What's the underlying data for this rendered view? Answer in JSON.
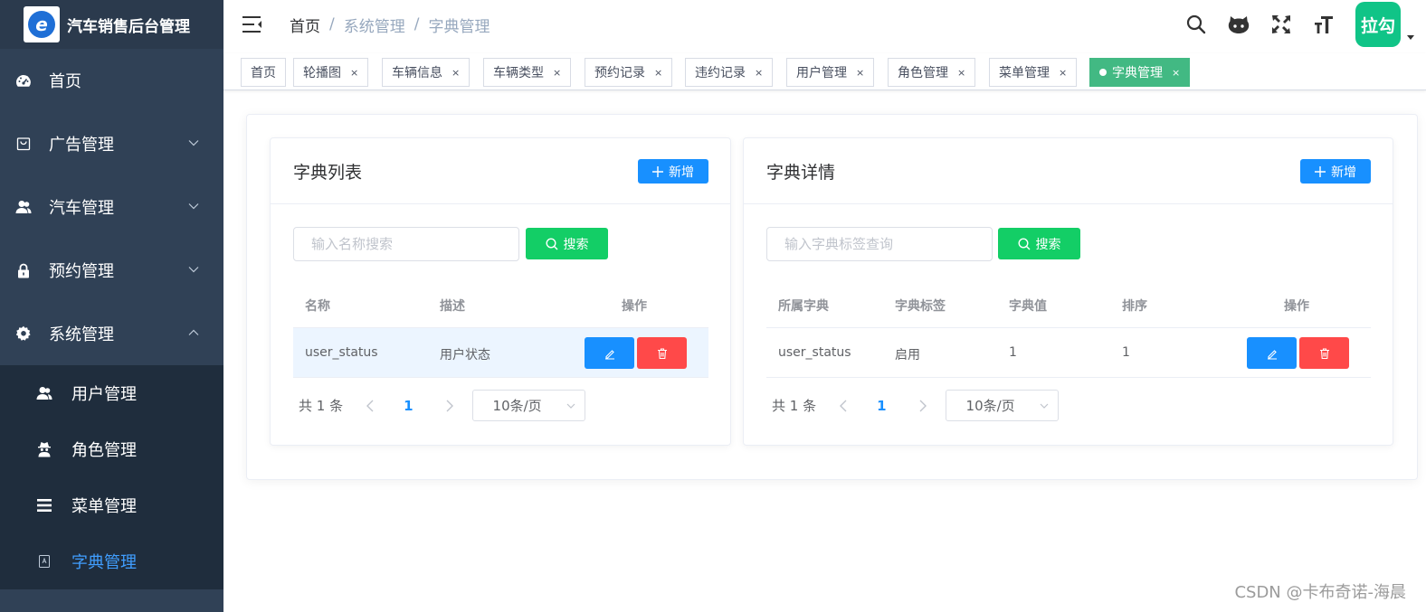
{
  "app": {
    "title": "汽车销售后台管理",
    "logo_letter": "e"
  },
  "sidebar": {
    "items": [
      {
        "label": "首页",
        "icon": "dashboard-icon"
      },
      {
        "label": "广告管理",
        "icon": "shopping-bag-icon"
      },
      {
        "label": "汽车管理",
        "icon": "users-icon"
      },
      {
        "label": "预约管理",
        "icon": "lock-icon"
      },
      {
        "label": "系统管理",
        "icon": "gear-icon"
      }
    ],
    "sub_items": [
      {
        "label": "用户管理",
        "icon": "users-icon"
      },
      {
        "label": "角色管理",
        "icon": "spy-icon"
      },
      {
        "label": "菜单管理",
        "icon": "menu-list-icon"
      },
      {
        "label": "字典管理",
        "icon": "dictionary-icon"
      }
    ],
    "active_sub": "字典管理"
  },
  "header": {
    "breadcrumb": [
      "首页",
      "系统管理",
      "字典管理"
    ],
    "breadcrumb_sep": "/",
    "avatar_text": "拉勾"
  },
  "tags": [
    {
      "label": "首页",
      "closable": false
    },
    {
      "label": "轮播图",
      "closable": true
    },
    {
      "label": "车辆信息",
      "closable": true
    },
    {
      "label": "车辆类型",
      "closable": true
    },
    {
      "label": "预约记录",
      "closable": true
    },
    {
      "label": "违约记录",
      "closable": true
    },
    {
      "label": "用户管理",
      "closable": true
    },
    {
      "label": "角色管理",
      "closable": true
    },
    {
      "label": "菜单管理",
      "closable": true
    },
    {
      "label": "字典管理",
      "closable": true,
      "active": true
    }
  ],
  "tag_close": "×",
  "left_panel": {
    "title": "字典列表",
    "add_label": "新增",
    "search_placeholder": "输入名称搜索",
    "search_label": "搜索",
    "columns": [
      "名称",
      "描述",
      "操作"
    ],
    "rows": [
      {
        "name": "user_status",
        "desc": "用户状态"
      }
    ],
    "pager": {
      "total": "共 1 条",
      "page": "1",
      "size": "10条/页"
    }
  },
  "right_panel": {
    "title": "字典详情",
    "add_label": "新增",
    "search_placeholder": "输入字典标签查询",
    "search_label": "搜索",
    "columns": [
      "所属字典",
      "字典标签",
      "字典值",
      "排序",
      "操作"
    ],
    "rows": [
      {
        "dict": "user_status",
        "label": "启用",
        "value": "1",
        "sort": "1"
      }
    ],
    "pager": {
      "total": "共 1 条",
      "page": "1",
      "size": "10条/页"
    }
  },
  "watermark": "CSDN @卡布奇诺-海晨",
  "colors": {
    "sidebar_bg": "#304156",
    "submenu_bg": "#1f2d3d",
    "active_menu": "#409eff",
    "primary": "#1890ff",
    "success": "#13ce66",
    "danger": "#ff4949",
    "tag_active": "#42b983",
    "avatar_bg": "#10c487"
  }
}
